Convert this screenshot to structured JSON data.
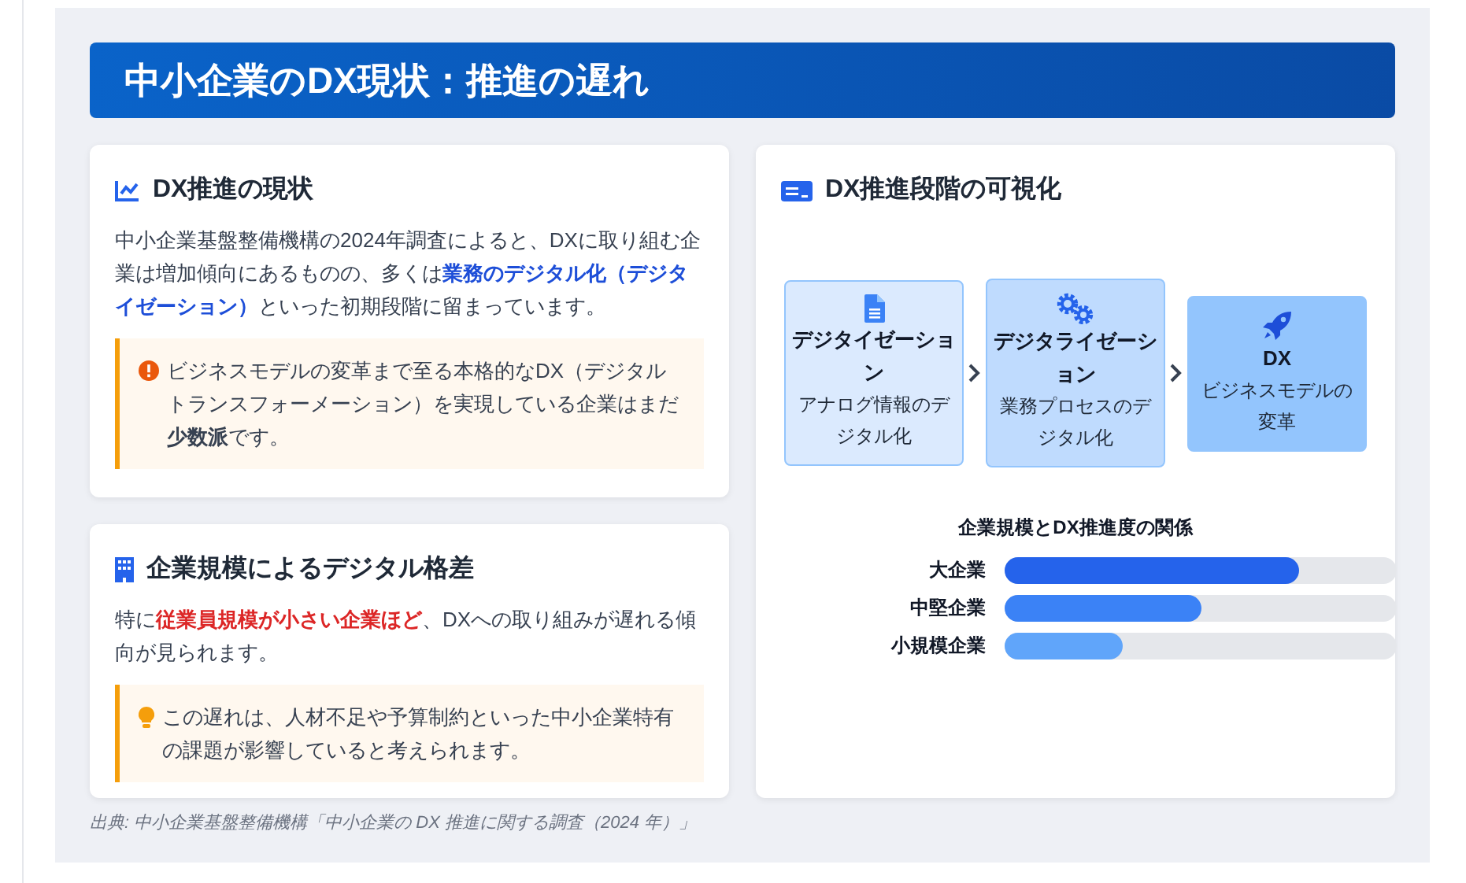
{
  "title": "中小企業のDX現状：推進の遅れ",
  "cards": [
    {
      "kind": "chart",
      "title": "DX推進の現状",
      "text": "中小企業基盤整備機構の2024年調査によると、DXに取り組む企業は増加傾向にあるものの、多くは**業務のデジタル化（デジタイゼーション）**といった初期段階に留まっています。",
      "note": {
        "kind": "alert",
        "text": "ビジネスモデルの変革まで至る本格的なDX（デジタルトランスフォーメーション）を実現している企業はまだ**少数派**です。"
      }
    },
    {
      "kind": "building",
      "title": "企業規模によるデジタル格差",
      "text": "特に**従業員規模が小さい企業ほど**、DXへの取り組みが遅れる傾向が見られます。",
      "note": {
        "kind": "bulb",
        "text": "この遅れは、人材不足や予算制約といった中小企業特有の課題が影響していると考えられます。"
      }
    }
  ],
  "stages_panel": {
    "title": "DX推進段階の可視化",
    "stages": [
      {
        "kind": "document",
        "name": "デジタイゼーション",
        "desc": "アナログ情報のデジタル化",
        "color": "#dbeafe"
      },
      {
        "kind": "gears",
        "name": "デジタライゼーション",
        "desc": "業務プロセスのデジタル化",
        "color": "#bfdbfe"
      },
      {
        "kind": "rocket",
        "name": "DX",
        "desc": "ビジネスモデルの変革",
        "color": "#93c5fd"
      }
    ],
    "bars_title": "企業規模とDX推進度の関係",
    "bars": [
      {
        "label": "大企業",
        "level": 0.75,
        "color": "#2563eb"
      },
      {
        "label": "中堅企業",
        "level": 0.5,
        "color": "#3b82f6"
      },
      {
        "label": "小規模企業",
        "level": 0.3,
        "color": "#60a5fa"
      }
    ]
  },
  "source": "出典: 中小企業基盤整備機構「中小企業の DX 推進に関する調査（2024 年）」"
}
